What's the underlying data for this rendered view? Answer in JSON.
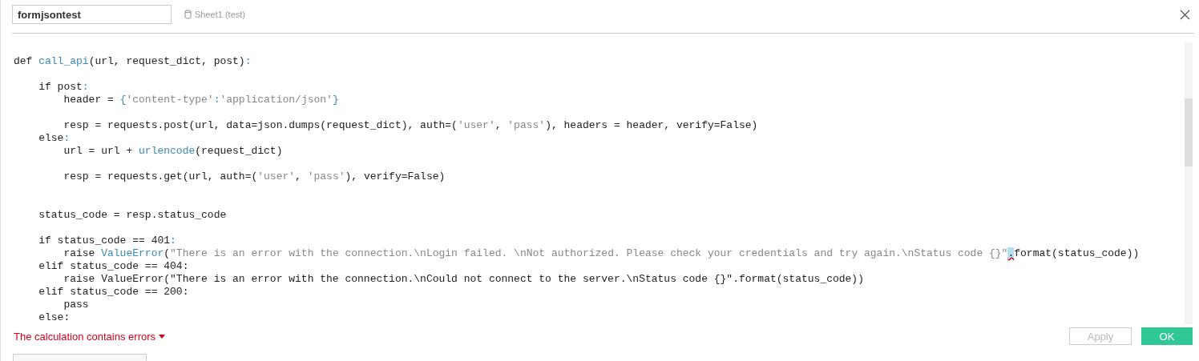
{
  "header": {
    "name_field": {
      "value": "formjsontest"
    },
    "data_source": "Sheet1 (test)"
  },
  "code_lines": [
    {
      "kind": "code",
      "tokens": [
        {
          "kind": "plain",
          "text": "def "
        },
        {
          "kind": "func",
          "text": "call_api"
        },
        {
          "kind": "plain",
          "text": "(url, request_dict, post)"
        },
        {
          "kind": "op",
          "text": ":"
        }
      ]
    },
    {
      "kind": "blank"
    },
    {
      "kind": "code",
      "tokens": [
        {
          "kind": "plain",
          "text": "    if post"
        },
        {
          "kind": "op",
          "text": ":"
        }
      ]
    },
    {
      "kind": "code",
      "tokens": [
        {
          "kind": "plain",
          "text": "        header = "
        },
        {
          "kind": "op",
          "text": "{"
        },
        {
          "kind": "string",
          "text": "'content-type'"
        },
        {
          "kind": "op",
          "text": ":"
        },
        {
          "kind": "string",
          "text": "'application/json'"
        },
        {
          "kind": "op",
          "text": "}"
        }
      ]
    },
    {
      "kind": "blank"
    },
    {
      "kind": "code",
      "tokens": [
        {
          "kind": "plain",
          "text": "        resp = requests.post(url, data=json.dumps(request_dict), auth=("
        },
        {
          "kind": "string",
          "text": "'user'"
        },
        {
          "kind": "plain",
          "text": ", "
        },
        {
          "kind": "string",
          "text": "'pass'"
        },
        {
          "kind": "plain",
          "text": "), headers = header, verify=False)"
        }
      ]
    },
    {
      "kind": "code",
      "tokens": [
        {
          "kind": "plain",
          "text": "    else"
        },
        {
          "kind": "op",
          "text": ":"
        }
      ]
    },
    {
      "kind": "code",
      "tokens": [
        {
          "kind": "plain",
          "text": "        url = url + "
        },
        {
          "kind": "func",
          "text": "urlencode"
        },
        {
          "kind": "plain",
          "text": "(request_dict)"
        }
      ]
    },
    {
      "kind": "blank"
    },
    {
      "kind": "code",
      "tokens": [
        {
          "kind": "plain",
          "text": "        resp = requests.get(url, auth=("
        },
        {
          "kind": "string",
          "text": "'user'"
        },
        {
          "kind": "plain",
          "text": ", "
        },
        {
          "kind": "string",
          "text": "'pass'"
        },
        {
          "kind": "plain",
          "text": "), verify=False)"
        }
      ]
    },
    {
      "kind": "blank"
    },
    {
      "kind": "blank"
    },
    {
      "kind": "code",
      "tokens": [
        {
          "kind": "plain",
          "text": "    status_code = resp.status_code"
        }
      ]
    },
    {
      "kind": "blank"
    },
    {
      "kind": "code",
      "tokens": [
        {
          "kind": "plain",
          "text": "    if status_code == 401"
        },
        {
          "kind": "op",
          "text": ":"
        }
      ]
    },
    {
      "kind": "code",
      "tokens": [
        {
          "kind": "plain",
          "text": "        raise "
        },
        {
          "kind": "func",
          "text": "ValueError"
        },
        {
          "kind": "plain",
          "text": "("
        },
        {
          "kind": "string",
          "text": "\"There is an error with the connection.\\nLogin failed. \\nNot authorized. Please check your credentials and try again.\\nStatus code {}\""
        },
        {
          "kind": "match",
          "text": "."
        },
        {
          "kind": "plain",
          "text": "format(status_code))"
        }
      ]
    },
    {
      "kind": "code",
      "tokens": [
        {
          "kind": "plain",
          "text": "    elif status_code == 404:"
        }
      ]
    },
    {
      "kind": "code",
      "tokens": [
        {
          "kind": "plain",
          "text": "        raise ValueError(\"There is an error with the connection.\\nCould not connect to the server.\\nStatus code {}\".format(status_code))"
        }
      ]
    },
    {
      "kind": "code",
      "tokens": [
        {
          "kind": "plain",
          "text": "    elif status_code == 200:"
        }
      ]
    },
    {
      "kind": "code",
      "tokens": [
        {
          "kind": "plain",
          "text": "        pass"
        }
      ]
    },
    {
      "kind": "code",
      "tokens": [
        {
          "kind": "plain",
          "text": "    else:"
        }
      ]
    }
  ],
  "footer": {
    "error_message": "The calculation contains errors",
    "buttons": [
      {
        "label": "Apply",
        "kind": "secondary",
        "disabled": true
      },
      {
        "label": "OK",
        "kind": "primary",
        "disabled": false
      }
    ]
  }
}
